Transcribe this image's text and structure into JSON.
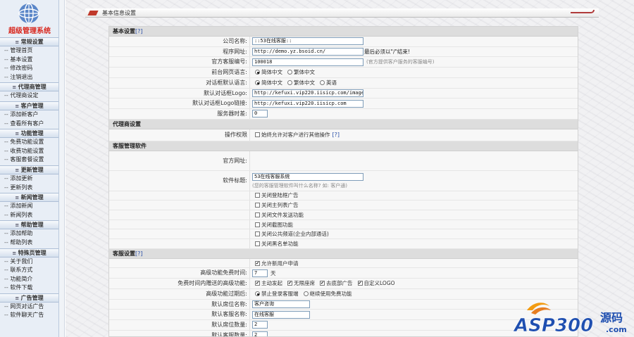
{
  "app": {
    "logo_text": "超级管理系统"
  },
  "sidebar": [
    {
      "title": "常规设置",
      "items": [
        "管理首页",
        "基本设置",
        "修改密码",
        "注销退出"
      ]
    },
    {
      "title": "代理商管理",
      "items": [
        "代理商设定"
      ]
    },
    {
      "title": "客户管理",
      "items": [
        "添加新客户",
        "查看所有客户"
      ]
    },
    {
      "title": "功能管理",
      "items": [
        "免费功能设置",
        "收费功能设置",
        "客服套餐设置"
      ]
    },
    {
      "title": "更新管理",
      "items": [
        "添加更新",
        "更新列表"
      ]
    },
    {
      "title": "新闻管理",
      "items": [
        "添加新闻",
        "新闻列表"
      ]
    },
    {
      "title": "帮助管理",
      "items": [
        "添加帮助",
        "帮助列表"
      ]
    },
    {
      "title": "特殊页管理",
      "items": [
        "关于我们",
        "联系方式",
        "功能简介",
        "软件下载"
      ]
    },
    {
      "title": "广告管理",
      "items": [
        "网页对话广告",
        "软件聊天广告"
      ]
    }
  ],
  "panel": {
    "title": "基本信息设置"
  },
  "basic": {
    "section": "基本设置",
    "help": "[?]",
    "company_label": "公司名称:",
    "company_value": "::53在线客服::",
    "program_url_label": "程序网址:",
    "program_url_value": "http://demo.yz.bsoid.cn/",
    "program_url_hint": "最后必须以\"/\"结束!",
    "cs_id_label": "官方客服编号:",
    "cs_id_value": "100018",
    "cs_id_hint": "(官方提供客户服务的客服编号)",
    "front_lang_label": "前台网页语言:",
    "lang_simplified": "简体中文",
    "lang_traditional": "繁体中文",
    "chat_lang_label": "对话框默认语言:",
    "lang_english": "英语",
    "chat_logo_label": "默认对话框Logo:",
    "chat_logo_value": "http://kefuxi.vip220.iisicp.com/images/lo",
    "chat_logo_link_label": "默认对话框Logo链接:",
    "chat_logo_link_value": "http://kefuxi.vip220.iisicp.com",
    "timezone_label": "服务器时差:",
    "timezone_value": "0"
  },
  "agent": {
    "section": "代理商设置",
    "perm_label": "操作权限",
    "perm_option": "始终允许对客户进行其他操作",
    "perm_help": "[?]"
  },
  "software": {
    "section": "客服管理软件",
    "site_label": "官方网址:",
    "title_label": "软件标题:",
    "title_value": "53在线客服系统",
    "title_hint": "(您的客服管理软件叫什么名称? 如: 客户通)",
    "options": [
      "关闭登陆框广告",
      "关闭主列表广告",
      "关闭文件发送功能",
      "关闭截图功能",
      "关闭公共频道(企业内部通话)",
      "关闭黑名单功能"
    ]
  },
  "service": {
    "section": "客服设置",
    "help": "[?]",
    "allow_register": "允许新用户申请",
    "advanced_days_label": "高级功能免费时间:",
    "advanced_days_value": "7",
    "advanced_days_unit": "天",
    "free_period_label": "免费时间内赠送的高级功能:",
    "free_features": [
      "主动发起",
      "无限座席",
      "去底部广告",
      "自定义LOGO"
    ],
    "expire_label": "高级功能过期后:",
    "expire_options": [
      "禁止登录客服端",
      "继续使用免费功能"
    ],
    "default_seat_name_label": "默认席位名称:",
    "default_seat_name_value": "客户咨询",
    "default_cs_name_label": "默认客服名称:",
    "default_cs_name_value": "在线客服",
    "default_seat_count_label": "默认席位数量:",
    "default_seat_count_value": "2",
    "default_cs_count_label": "默认客服数量:",
    "default_cs_count_value": "2"
  },
  "watermark": {
    "brand": "ASP300",
    "cn": "源码",
    "domain": ".com"
  }
}
